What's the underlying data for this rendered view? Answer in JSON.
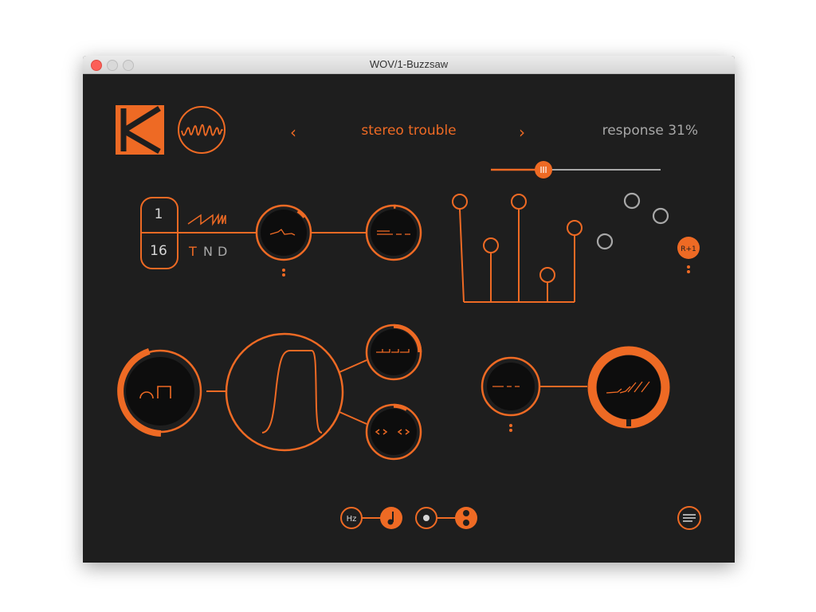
{
  "window": {
    "title": "WOV/1-Buzzsaw"
  },
  "preset": {
    "name": "stereo trouble",
    "prev": "‹",
    "next": "›"
  },
  "response": {
    "label": "response 31%",
    "fraction": 0.31
  },
  "tempo": {
    "numerator": "1",
    "denominator": "16"
  },
  "modes": [
    {
      "label": "T",
      "active": true
    },
    {
      "label": "N",
      "active": false
    },
    {
      "label": "D",
      "active": false
    }
  ],
  "badge": {
    "label": "R+1"
  },
  "toggles": {
    "hz_label": "Hz"
  },
  "colors": {
    "accent": "#ee6a24",
    "background": "#1e1e1e",
    "inactive": "#a8a8a8",
    "knob_face": "#0d0d0d"
  }
}
